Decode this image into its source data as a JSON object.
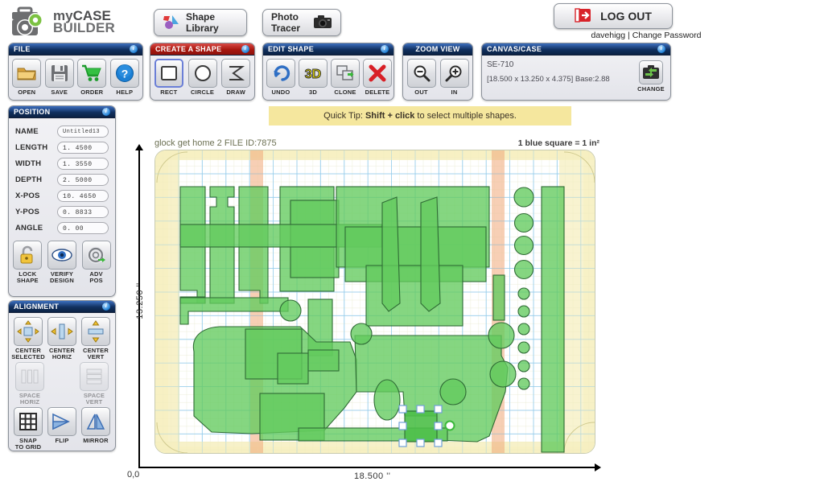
{
  "brand": {
    "line1_my": "my",
    "line1_case": "CASE",
    "line2": "BUILDER",
    "icon": "toolbox-gear-logo"
  },
  "header": {
    "shape_library_label": "Shape Library",
    "shape_library_icon": "shapes-icon",
    "photo_tracer_label": "Photo Tracer",
    "photo_tracer_icon": "camera-icon",
    "logout_label": "LOG OUT",
    "logout_icon": "logout-arrow-icon",
    "username": "davehigg",
    "separator": "|",
    "change_password_label": "Change Password"
  },
  "panels": {
    "file": {
      "title": "FILE",
      "info_icon": "info-icon",
      "buttons": [
        {
          "label": "OPEN",
          "icon": "folder-icon"
        },
        {
          "label": "SAVE",
          "icon": "floppy-disk-icon"
        },
        {
          "label": "ORDER",
          "icon": "shopping-cart-icon"
        },
        {
          "label": "HELP",
          "icon": "question-mark-icon"
        }
      ]
    },
    "create": {
      "title": "CREATE A SHAPE",
      "info_icon": "info-icon",
      "buttons": [
        {
          "label": "RECT",
          "icon": "rectangle-icon",
          "selected": true
        },
        {
          "label": "CIRCLE",
          "icon": "circle-icon",
          "selected": false
        },
        {
          "label": "DRAW",
          "icon": "polyline-draw-icon",
          "selected": false
        }
      ]
    },
    "edit": {
      "title": "EDIT SHAPE",
      "info_icon": "info-icon",
      "buttons": [
        {
          "label": "UNDO",
          "icon": "undo-arrow-icon"
        },
        {
          "label": "3D",
          "icon": "3d-text-icon"
        },
        {
          "label": "CLONE",
          "icon": "clone-copy-icon"
        },
        {
          "label": "DELETE",
          "icon": "red-x-icon"
        }
      ]
    },
    "zoom": {
      "title": "ZOOM VIEW",
      "buttons": [
        {
          "label": "OUT",
          "icon": "magnifier-minus-icon"
        },
        {
          "label": "IN",
          "icon": "magnifier-plus-icon"
        }
      ]
    },
    "canvas_case": {
      "title": "CANVAS/CASE",
      "info_icon": "info-icon",
      "case_name": "SE-710",
      "dimensions": "[18.500 x 13.250 x 4.375] Base:2.88",
      "change_label": "CHANGE",
      "change_icon": "case-swap-icon"
    },
    "position": {
      "title": "POSITION",
      "info_icon": "info-icon",
      "fields": [
        {
          "label": "NAME",
          "value": "Untitled13"
        },
        {
          "label": "LENGTH",
          "value": "1. 4500"
        },
        {
          "label": "WIDTH",
          "value": "1. 3550"
        },
        {
          "label": "DEPTH",
          "value": "2. 5000"
        },
        {
          "label": "X-POS",
          "value": "10. 4650"
        },
        {
          "label": "Y-POS",
          "value": "0. 8833"
        },
        {
          "label": "ANGLE",
          "value": "0. 00"
        }
      ],
      "buttons": [
        {
          "label": "LOCK\nSHAPE",
          "icon": "padlock-open-icon"
        },
        {
          "label": "VERIFY\nDESIGN",
          "icon": "eye-icon"
        },
        {
          "label": "ADV\nPOS",
          "icon": "gear-arrow-icon"
        }
      ]
    },
    "alignment": {
      "title": "ALIGNMENT",
      "info_icon": "info-icon",
      "buttons": [
        {
          "label": "CENTER\nSELECTED",
          "icon": "center-selected-icon",
          "enabled": true
        },
        {
          "label": "CENTER\nHORIZ",
          "icon": "center-horizontal-icon",
          "enabled": true
        },
        {
          "label": "CENTER\nVERT",
          "icon": "center-vertical-icon",
          "enabled": true
        },
        {
          "label": "SPACE\nHORIZ",
          "icon": "space-horizontal-icon",
          "enabled": false
        },
        {
          "label": "SPACE\nVERT",
          "icon": "space-vertical-icon",
          "enabled": false
        },
        {
          "label": "SNAP\nTO GRID",
          "icon": "grid-icon",
          "enabled": true
        },
        {
          "label": "FLIP",
          "icon": "flip-triangle-icon",
          "enabled": true
        },
        {
          "label": "MIRROR",
          "icon": "mirror-triangle-icon",
          "enabled": true
        }
      ]
    }
  },
  "tip": {
    "prefix": "Quick Tip:",
    "bold": "Shift + click",
    "suffix": "to select multiple shapes."
  },
  "canvas": {
    "design_title": "glock get home 2 FILE ID:7875",
    "scale_note": "1 blue square = 1 in²",
    "y_axis_label": "13.250 ''",
    "x_axis_label": "18.500 ''",
    "origin_label": "0,0",
    "grid_blue": "#9fd0ef",
    "case_fill": "#fdfbe8",
    "shape_fill": "#63cb5e",
    "shape_stroke": "#2f6b35",
    "selected_shape_fill": "#4cbf48",
    "handle_fill": "#ffffff",
    "handle_stroke": "#6f9fd8"
  }
}
